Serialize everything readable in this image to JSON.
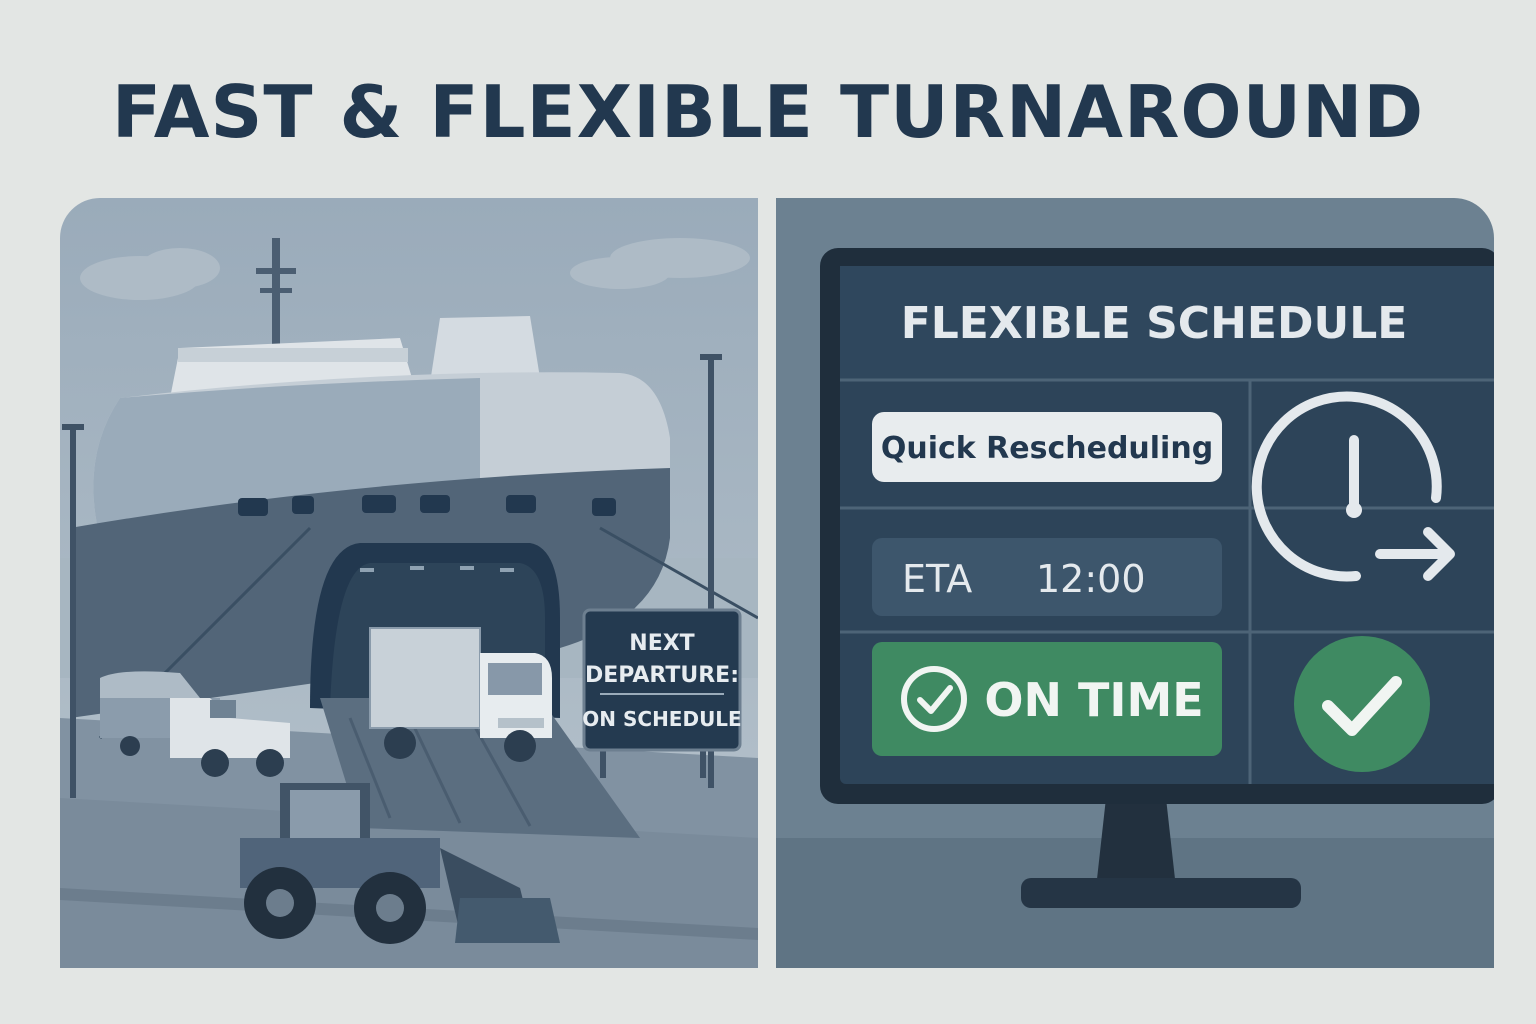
{
  "headline": "FAST & FLEXIBLE TURNAROUND",
  "left_scene": {
    "sign_line1": "NEXT",
    "sign_line2": "DEPARTURE:",
    "sign_line3": "ON SCHEDULE"
  },
  "monitor": {
    "title": "FLEXIBLE SCHEDULE",
    "button_label": "Quick Rescheduling",
    "eta_label": "ETA",
    "eta_time": "12:00",
    "status_label": "ON TIME",
    "icons": [
      "clock-arrow-icon",
      "check-circle-icon"
    ]
  },
  "colors": {
    "navy": "#22384f",
    "status_green": "#3f8a62",
    "background": "#e3e6e4"
  }
}
